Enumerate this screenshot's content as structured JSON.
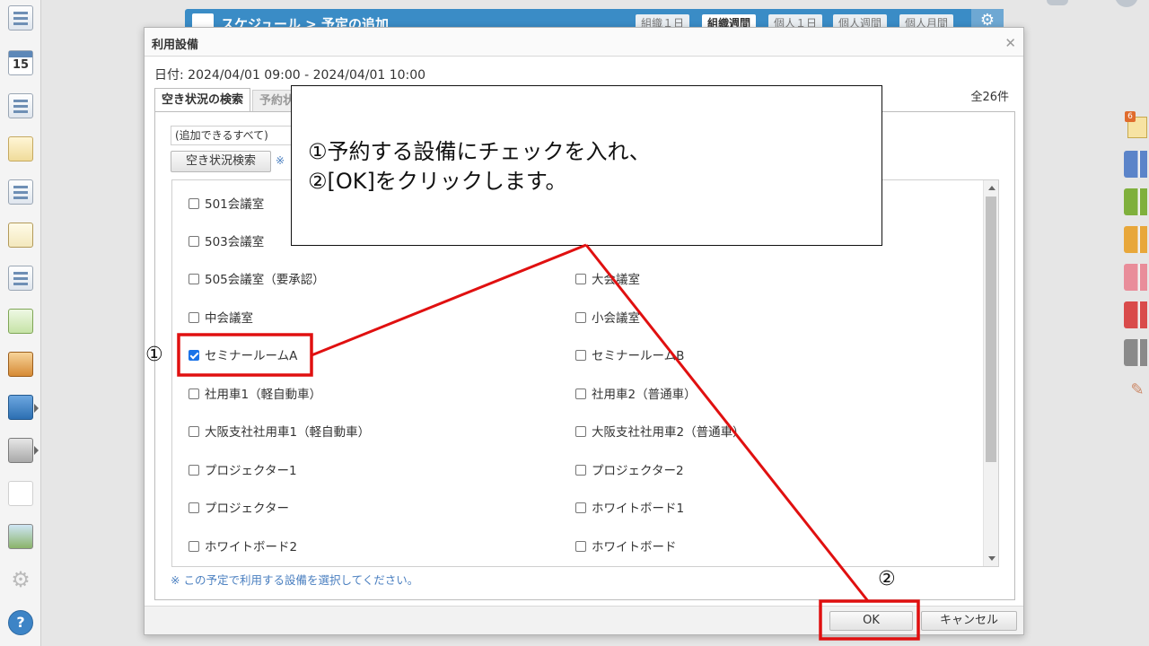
{
  "background": {
    "header_title": "スケジュール > 予定の追加",
    "view_tabs": [
      "組織１日",
      "組織週間",
      "個人１日",
      "個人週間",
      "個人月間"
    ],
    "active_view_tab": "組織週間",
    "calendar_icon_day": "15"
  },
  "dialog": {
    "title": "利用設備",
    "date_line": "日付: 2024/04/01 09:00 - 2024/04/01 10:00",
    "tabs": [
      {
        "label": "空き状況の検索",
        "active": true
      },
      {
        "label": "予約状況",
        "active": false
      }
    ],
    "total_count": "全26件",
    "scope_select_value": "(追加できるすべて)",
    "search_button_label": "空き状況検索",
    "search_note": "※",
    "facilities": [
      {
        "label": "501会議室",
        "checked": false
      },
      {
        "label": "",
        "checked": false
      },
      {
        "label": "503会議室",
        "checked": false
      },
      {
        "label": "",
        "checked": false
      },
      {
        "label": "505会議室（要承認）",
        "checked": false
      },
      {
        "label": "大会議室",
        "checked": false
      },
      {
        "label": "中会議室",
        "checked": false
      },
      {
        "label": "小会議室",
        "checked": false
      },
      {
        "label": "セミナールームA",
        "checked": true
      },
      {
        "label": "セミナールームB",
        "checked": false
      },
      {
        "label": "社用車1（軽自動車）",
        "checked": false
      },
      {
        "label": "社用車2（普通車）",
        "checked": false
      },
      {
        "label": "大阪支社社用車1（軽自動車）",
        "checked": false
      },
      {
        "label": "大阪支社社用車2（普通車）",
        "checked": false
      },
      {
        "label": "プロジェクター1",
        "checked": false
      },
      {
        "label": "プロジェクター2",
        "checked": false
      },
      {
        "label": "プロジェクター",
        "checked": false
      },
      {
        "label": "ホワイトボード1",
        "checked": false
      },
      {
        "label": "ホワイトボード2",
        "checked": false
      },
      {
        "label": "ホワイトボード",
        "checked": false
      }
    ],
    "hint": "※ この予定で利用する設備を選択してください。",
    "ok_label": "OK",
    "cancel_label": "キャンセル"
  },
  "annotation": {
    "line1": "①予約する設備にチェックを入れ、",
    "line2": "②[OK]をクリックします。",
    "marker1": "①",
    "marker2": "②",
    "highlight_color": "#e01010"
  },
  "right_rail": {
    "badge": "6",
    "colors": [
      "#5b84c9",
      "#7fb03c",
      "#e8a73a",
      "#e98d9a",
      "#d94b4b",
      "#8a8a8a"
    ]
  },
  "icons": [
    "dashboard-icon",
    "calendar-icon",
    "workflow-icon",
    "memo-icon",
    "report-icon",
    "todo-icon",
    "search-doc-icon",
    "refresh-icon",
    "cabinet-icon",
    "neo-icon",
    "folder-icon",
    "app-icon",
    "photo-icon",
    "gear-icon",
    "help-icon"
  ]
}
